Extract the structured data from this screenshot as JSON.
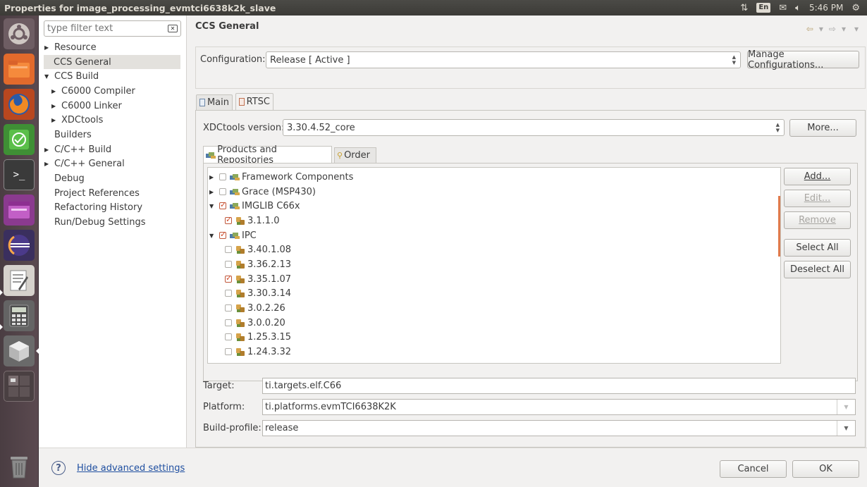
{
  "window": {
    "title": "Properties for image_processing_evmtci6638k2k_slave"
  },
  "topbar": {
    "lang": "En",
    "time": "5:46 PM"
  },
  "launcher": {
    "items": [
      "ubuntu-dash",
      "files",
      "firefox",
      "system-monitor",
      "terminal",
      "app",
      "eclipse",
      "text-editor",
      "calculator",
      "software-center",
      "workspace-switcher",
      "trash"
    ]
  },
  "sidebar": {
    "filter_placeholder": "type filter text",
    "items": [
      {
        "label": "Resource",
        "indent": 0,
        "expander": "▶"
      },
      {
        "label": "CCS General",
        "indent": 0,
        "expander": ""
      },
      {
        "label": "CCS Build",
        "indent": 0,
        "expander": "▼"
      },
      {
        "label": "C6000 Compiler",
        "indent": 1,
        "expander": "▶"
      },
      {
        "label": "C6000 Linker",
        "indent": 1,
        "expander": "▶"
      },
      {
        "label": "XDCtools",
        "indent": 1,
        "expander": "▶"
      },
      {
        "label": "Builders",
        "indent": 0,
        "expander": ""
      },
      {
        "label": "C/C++ Build",
        "indent": 0,
        "expander": "▶"
      },
      {
        "label": "C/C++ General",
        "indent": 0,
        "expander": "▶"
      },
      {
        "label": "Debug",
        "indent": 0,
        "expander": ""
      },
      {
        "label": "Project References",
        "indent": 0,
        "expander": ""
      },
      {
        "label": "Refactoring History",
        "indent": 0,
        "expander": ""
      },
      {
        "label": "Run/Debug Settings",
        "indent": 0,
        "expander": ""
      }
    ]
  },
  "main": {
    "title": "CCS General",
    "configuration_label": "Configuration:",
    "configuration_value": "Release  [ Active ]",
    "manage_button": "Manage Configurations...",
    "tabs": [
      "Main",
      "RTSC"
    ],
    "xdctools_label": "XDCtools version:",
    "xdctools_value": "3.30.4.52_core",
    "more_button": "More...",
    "subtabs": [
      "Products and Repositories",
      "Order"
    ],
    "products": [
      {
        "label": "Framework Components",
        "type": "product",
        "expander": "▶",
        "checked": false
      },
      {
        "label": "Grace (MSP430)",
        "type": "product",
        "expander": "▶",
        "checked": false
      },
      {
        "label": "IMGLIB C66x",
        "type": "product",
        "expander": "▼",
        "checked": true
      },
      {
        "label": "3.1.1.0",
        "type": "version",
        "expander": "",
        "checked": true
      },
      {
        "label": "IPC",
        "type": "product",
        "expander": "▼",
        "checked": true
      },
      {
        "label": "3.40.1.08",
        "type": "version",
        "expander": "",
        "checked": false
      },
      {
        "label": "3.36.2.13",
        "type": "version",
        "expander": "",
        "checked": false
      },
      {
        "label": "3.35.1.07",
        "type": "version",
        "expander": "",
        "checked": true
      },
      {
        "label": "3.30.3.14",
        "type": "version",
        "expander": "",
        "checked": false
      },
      {
        "label": "3.0.2.26",
        "type": "version",
        "expander": "",
        "checked": false
      },
      {
        "label": "3.0.0.20",
        "type": "version",
        "expander": "",
        "checked": false
      },
      {
        "label": "1.25.3.15",
        "type": "version",
        "expander": "",
        "checked": false
      },
      {
        "label": "1.24.3.32",
        "type": "version",
        "expander": "",
        "checked": false
      }
    ],
    "side_buttons": {
      "add": "Add...",
      "edit": "Edit...",
      "remove": "Remove",
      "select_all": "Select All",
      "deselect_all": "Deselect All"
    },
    "target_label": "Target:",
    "target_value": "ti.targets.elf.C66",
    "platform_label": "Platform:",
    "platform_value": "ti.platforms.evmTCI6638K2K",
    "buildprofile_label": "Build-profile:",
    "buildprofile_value": "release"
  },
  "footer": {
    "help_icon": "?",
    "advanced_link": "Hide advanced settings",
    "cancel": "Cancel",
    "ok": "OK"
  },
  "colors": {
    "accent": "#e07a4b",
    "launcher": "#5b4a50",
    "topbar": "#3c3b37",
    "link": "#1f4fa0"
  }
}
